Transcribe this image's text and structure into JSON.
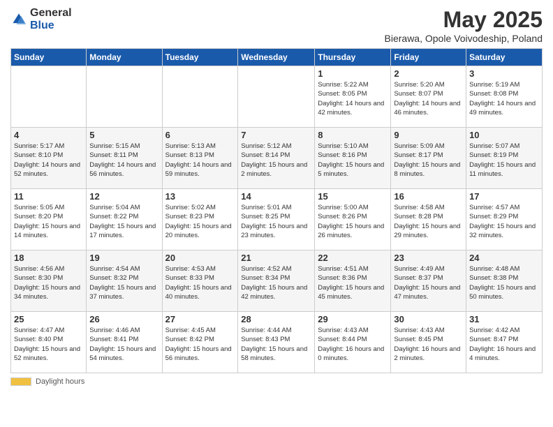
{
  "header": {
    "logo_general": "General",
    "logo_blue": "Blue",
    "title": "May 2025",
    "subtitle": "Bierawa, Opole Voivodeship, Poland"
  },
  "days_of_week": [
    "Sunday",
    "Monday",
    "Tuesday",
    "Wednesday",
    "Thursday",
    "Friday",
    "Saturday"
  ],
  "weeks": [
    [
      {
        "day": "",
        "info": ""
      },
      {
        "day": "",
        "info": ""
      },
      {
        "day": "",
        "info": ""
      },
      {
        "day": "",
        "info": ""
      },
      {
        "day": "1",
        "info": "Sunrise: 5:22 AM\nSunset: 8:05 PM\nDaylight: 14 hours and 42 minutes."
      },
      {
        "day": "2",
        "info": "Sunrise: 5:20 AM\nSunset: 8:07 PM\nDaylight: 14 hours and 46 minutes."
      },
      {
        "day": "3",
        "info": "Sunrise: 5:19 AM\nSunset: 8:08 PM\nDaylight: 14 hours and 49 minutes."
      }
    ],
    [
      {
        "day": "4",
        "info": "Sunrise: 5:17 AM\nSunset: 8:10 PM\nDaylight: 14 hours and 52 minutes."
      },
      {
        "day": "5",
        "info": "Sunrise: 5:15 AM\nSunset: 8:11 PM\nDaylight: 14 hours and 56 minutes."
      },
      {
        "day": "6",
        "info": "Sunrise: 5:13 AM\nSunset: 8:13 PM\nDaylight: 14 hours and 59 minutes."
      },
      {
        "day": "7",
        "info": "Sunrise: 5:12 AM\nSunset: 8:14 PM\nDaylight: 15 hours and 2 minutes."
      },
      {
        "day": "8",
        "info": "Sunrise: 5:10 AM\nSunset: 8:16 PM\nDaylight: 15 hours and 5 minutes."
      },
      {
        "day": "9",
        "info": "Sunrise: 5:09 AM\nSunset: 8:17 PM\nDaylight: 15 hours and 8 minutes."
      },
      {
        "day": "10",
        "info": "Sunrise: 5:07 AM\nSunset: 8:19 PM\nDaylight: 15 hours and 11 minutes."
      }
    ],
    [
      {
        "day": "11",
        "info": "Sunrise: 5:05 AM\nSunset: 8:20 PM\nDaylight: 15 hours and 14 minutes."
      },
      {
        "day": "12",
        "info": "Sunrise: 5:04 AM\nSunset: 8:22 PM\nDaylight: 15 hours and 17 minutes."
      },
      {
        "day": "13",
        "info": "Sunrise: 5:02 AM\nSunset: 8:23 PM\nDaylight: 15 hours and 20 minutes."
      },
      {
        "day": "14",
        "info": "Sunrise: 5:01 AM\nSunset: 8:25 PM\nDaylight: 15 hours and 23 minutes."
      },
      {
        "day": "15",
        "info": "Sunrise: 5:00 AM\nSunset: 8:26 PM\nDaylight: 15 hours and 26 minutes."
      },
      {
        "day": "16",
        "info": "Sunrise: 4:58 AM\nSunset: 8:28 PM\nDaylight: 15 hours and 29 minutes."
      },
      {
        "day": "17",
        "info": "Sunrise: 4:57 AM\nSunset: 8:29 PM\nDaylight: 15 hours and 32 minutes."
      }
    ],
    [
      {
        "day": "18",
        "info": "Sunrise: 4:56 AM\nSunset: 8:30 PM\nDaylight: 15 hours and 34 minutes."
      },
      {
        "day": "19",
        "info": "Sunrise: 4:54 AM\nSunset: 8:32 PM\nDaylight: 15 hours and 37 minutes."
      },
      {
        "day": "20",
        "info": "Sunrise: 4:53 AM\nSunset: 8:33 PM\nDaylight: 15 hours and 40 minutes."
      },
      {
        "day": "21",
        "info": "Sunrise: 4:52 AM\nSunset: 8:34 PM\nDaylight: 15 hours and 42 minutes."
      },
      {
        "day": "22",
        "info": "Sunrise: 4:51 AM\nSunset: 8:36 PM\nDaylight: 15 hours and 45 minutes."
      },
      {
        "day": "23",
        "info": "Sunrise: 4:49 AM\nSunset: 8:37 PM\nDaylight: 15 hours and 47 minutes."
      },
      {
        "day": "24",
        "info": "Sunrise: 4:48 AM\nSunset: 8:38 PM\nDaylight: 15 hours and 50 minutes."
      }
    ],
    [
      {
        "day": "25",
        "info": "Sunrise: 4:47 AM\nSunset: 8:40 PM\nDaylight: 15 hours and 52 minutes."
      },
      {
        "day": "26",
        "info": "Sunrise: 4:46 AM\nSunset: 8:41 PM\nDaylight: 15 hours and 54 minutes."
      },
      {
        "day": "27",
        "info": "Sunrise: 4:45 AM\nSunset: 8:42 PM\nDaylight: 15 hours and 56 minutes."
      },
      {
        "day": "28",
        "info": "Sunrise: 4:44 AM\nSunset: 8:43 PM\nDaylight: 15 hours and 58 minutes."
      },
      {
        "day": "29",
        "info": "Sunrise: 4:43 AM\nSunset: 8:44 PM\nDaylight: 16 hours and 0 minutes."
      },
      {
        "day": "30",
        "info": "Sunrise: 4:43 AM\nSunset: 8:45 PM\nDaylight: 16 hours and 2 minutes."
      },
      {
        "day": "31",
        "info": "Sunrise: 4:42 AM\nSunset: 8:47 PM\nDaylight: 16 hours and 4 minutes."
      }
    ]
  ],
  "footer": {
    "daylight_label": "Daylight hours"
  }
}
